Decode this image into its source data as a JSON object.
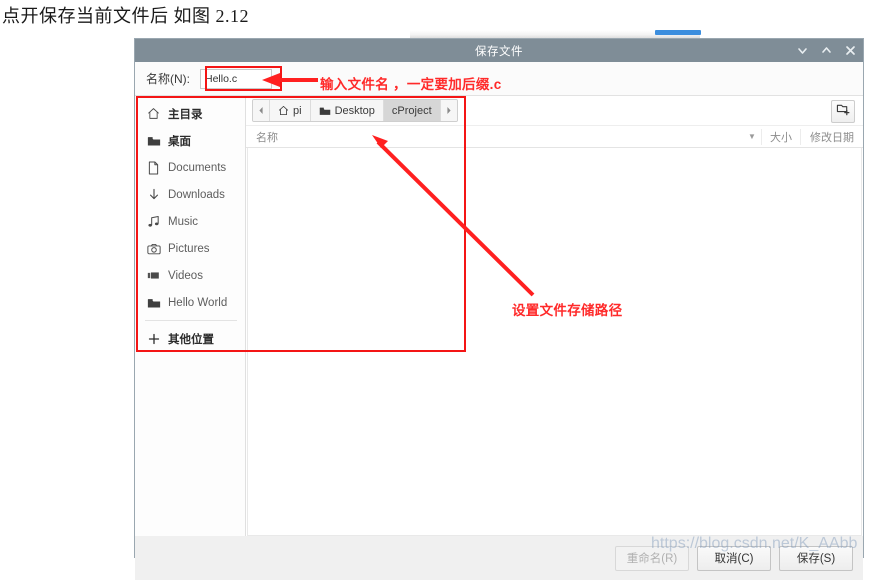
{
  "caption": "点开保存当前文件后  如图 2.12",
  "dialog": {
    "title": "保存文件",
    "window_buttons": {
      "minimize": "minimize-icon",
      "maximize": "maximize-icon",
      "close": "close-icon"
    },
    "name_row": {
      "label": "名称(N):",
      "value": "Hello.c",
      "placeholder": ""
    },
    "sidebar": {
      "items": [
        {
          "label": "主目录",
          "icon": "home-icon",
          "bold": true
        },
        {
          "label": "桌面",
          "icon": "folder-icon",
          "bold": true
        },
        {
          "label": "Documents",
          "icon": "document-icon",
          "bold": false
        },
        {
          "label": "Downloads",
          "icon": "download-icon",
          "bold": false
        },
        {
          "label": "Music",
          "icon": "music-icon",
          "bold": false
        },
        {
          "label": "Pictures",
          "icon": "camera-icon",
          "bold": false
        },
        {
          "label": "Videos",
          "icon": "video-icon",
          "bold": false
        },
        {
          "label": "Hello World",
          "icon": "folder-icon",
          "bold": false
        }
      ],
      "other_locations": {
        "label": "其他位置",
        "icon": "plus-icon"
      }
    },
    "path_bar": {
      "prev_arrow": "chevron-left-icon",
      "next_arrow": "chevron-right-icon",
      "crumbs": [
        {
          "label": "pi",
          "icon": "home-icon",
          "active": false
        },
        {
          "label": "Desktop",
          "icon": "folder-icon",
          "active": false
        },
        {
          "label": "cProject",
          "icon": "",
          "active": true
        }
      ],
      "new_folder_button": "create-folder-icon"
    },
    "columns": {
      "name": "名称",
      "sort": "▼",
      "size": "大小",
      "modified": "修改日期"
    },
    "files": [],
    "footer": {
      "rename": "重命名(R)",
      "cancel": "取消(C)",
      "save": "保存(S)"
    }
  },
  "annotations": {
    "filename_note": "输入文件名 ，一定要加后缀.c",
    "path_note": "设置文件存储路径",
    "color": "#ff2a2a"
  },
  "watermark": "https://blog.csdn.net/K_AAbb"
}
